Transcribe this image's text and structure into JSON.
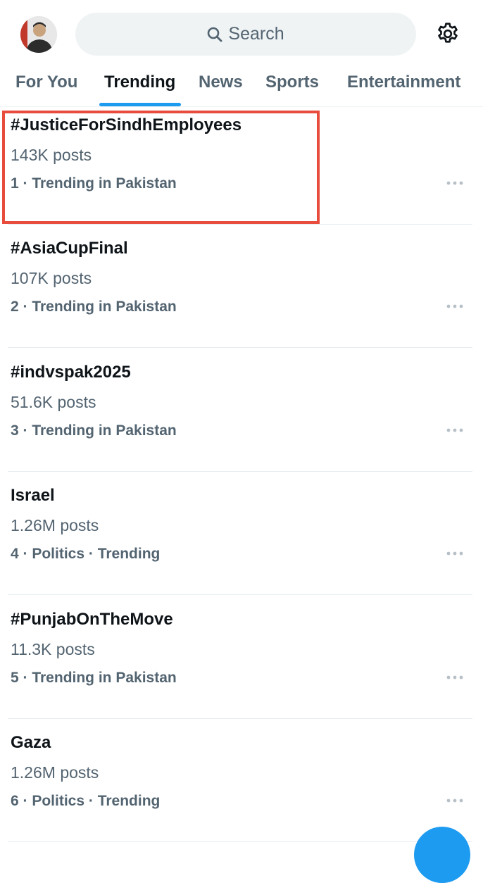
{
  "search": {
    "label": "Search"
  },
  "tabs": [
    {
      "label": "For You",
      "active": false
    },
    {
      "label": "Trending",
      "active": true
    },
    {
      "label": "News",
      "active": false
    },
    {
      "label": "Sports",
      "active": false
    },
    {
      "label": "Entertainment",
      "active": false
    }
  ],
  "trends": [
    {
      "name": "#JusticeForSindhEmployees",
      "posts": "143K posts",
      "meta": "1 · Trending in Pakistan",
      "highlighted": true
    },
    {
      "name": "#AsiaCupFinal",
      "posts": "107K posts",
      "meta": "2 · Trending in Pakistan"
    },
    {
      "name": "#indvspak2025",
      "posts": "51.6K posts",
      "meta": "3 · Trending in Pakistan"
    },
    {
      "name": "Israel",
      "posts": "1.26M posts",
      "meta": "4 · Politics · Trending"
    },
    {
      "name": "#PunjabOnTheMove",
      "posts": "11.3K posts",
      "meta": "5 · Trending in Pakistan"
    },
    {
      "name": "Gaza",
      "posts": "1.26M posts",
      "meta": "6 · Politics · Trending"
    }
  ],
  "colors": {
    "accent": "#1d9bf0",
    "highlight_border": "#e74c3c",
    "secondary_text": "#536471",
    "search_bg": "#eff3f4"
  },
  "icons": {
    "search": "search-icon",
    "settings": "gear-icon",
    "more": "more-horizontal-icon",
    "avatar": "avatar"
  }
}
